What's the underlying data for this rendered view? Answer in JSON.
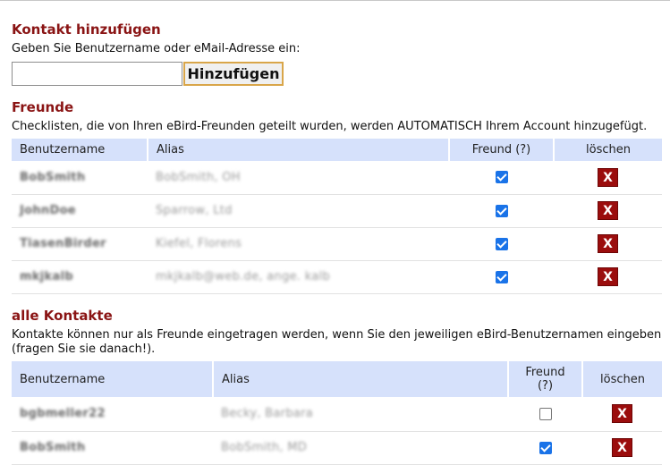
{
  "add_contact": {
    "heading": "Kontakt hinzufügen",
    "instruction": "Geben Sie Benutzername oder eMail-Adresse ein:",
    "input_value": "",
    "button_label": "Hinzufügen"
  },
  "friends": {
    "heading": "Freunde",
    "description": "Checklisten, die von Ihren eBird-Freunden geteilt wurden, werden AUTOMATISCH Ihrem Account hinzugefügt.",
    "columns": [
      "Benutzername",
      "Alias",
      "Freund (?)",
      "löschen"
    ],
    "rows": [
      {
        "username": "BobSmith",
        "alias": "BobSmith, OH",
        "friend": true,
        "delete_label": "X"
      },
      {
        "username": "JohnDoe",
        "alias": "Sparrow, Ltd",
        "friend": true,
        "delete_label": "X"
      },
      {
        "username": "TiasenBirder",
        "alias": "Kiefel, Florens",
        "friend": true,
        "delete_label": "X"
      },
      {
        "username": "mkjkalb",
        "alias": "mkjkalb@web.de, ange. kalb",
        "friend": true,
        "delete_label": "X"
      }
    ]
  },
  "all_contacts": {
    "heading": "alle Kontakte",
    "description": "Kontakte können nur als Freunde eingetragen werden, wenn Sie den jeweiligen eBird-Benutzernamen eingeben (fragen Sie sie danach!).",
    "columns": [
      "Benutzername",
      "Alias",
      "Freund (?)",
      "löschen"
    ],
    "rows": [
      {
        "username": "bgbmeller22",
        "alias": "Becky, Barbara",
        "friend": false,
        "delete_label": "X"
      },
      {
        "username": "BobSmith",
        "alias": "BobSmith, MD",
        "friend": true,
        "delete_label": "X"
      }
    ]
  }
}
